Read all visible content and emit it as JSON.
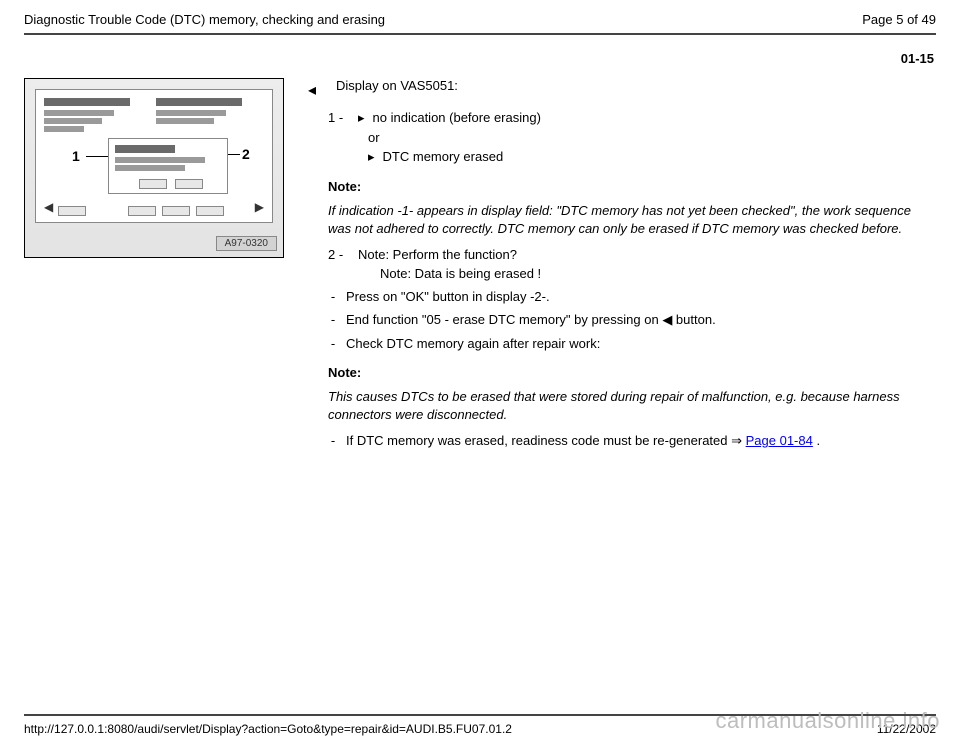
{
  "header": {
    "title": "Diagnostic Trouble Code (DTC) memory, checking and erasing",
    "page_of": "Page 5 of 49"
  },
  "section_number": "01-15",
  "figure": {
    "callout1": "1",
    "callout2": "2",
    "ref": "A97-0320"
  },
  "body": {
    "lead_arrow": "◂",
    "lead_text": "Display on VAS5051:",
    "item1_num": "1 - ",
    "item1_bullet": "▸",
    "item1_text": "no indication (before erasing)",
    "item1_or": "or",
    "item1_bullet2": "▸",
    "item1_text2": "DTC memory erased",
    "note1_h": "Note:",
    "note1_body": "If indication -1- appears in display field: \"DTC memory has not yet been checked\", the work sequence was not adhered to correctly. DTC memory can only be erased if DTC memory was checked before.",
    "item2_num": "2 - ",
    "item2_text": "Note: Perform the function?",
    "item2_sub": "Note: Data is being erased !",
    "dash1": "Press on \"OK\" button in display -2-.",
    "dash2a": "End function \"05 - erase DTC memory\" by pressing on ",
    "dash2_icon": "◀",
    "dash2b": " button.",
    "dash3": "Check DTC memory again after repair work:",
    "note2_h": "Note:",
    "note2_body": "This causes DTCs to be erased that were stored during repair of malfunction, e.g. because harness connectors were disconnected.",
    "dash4a": "If DTC memory was erased, readiness code must be re-generated  ⇒ ",
    "dash4_link": "Page 01-84",
    "dash4b": " ."
  },
  "footer": {
    "url": "http://127.0.0.1:8080/audi/servlet/Display?action=Goto&type=repair&id=AUDI.B5.FU07.01.2",
    "date": "11/22/2002"
  },
  "watermark": "carmanualsonline.info"
}
